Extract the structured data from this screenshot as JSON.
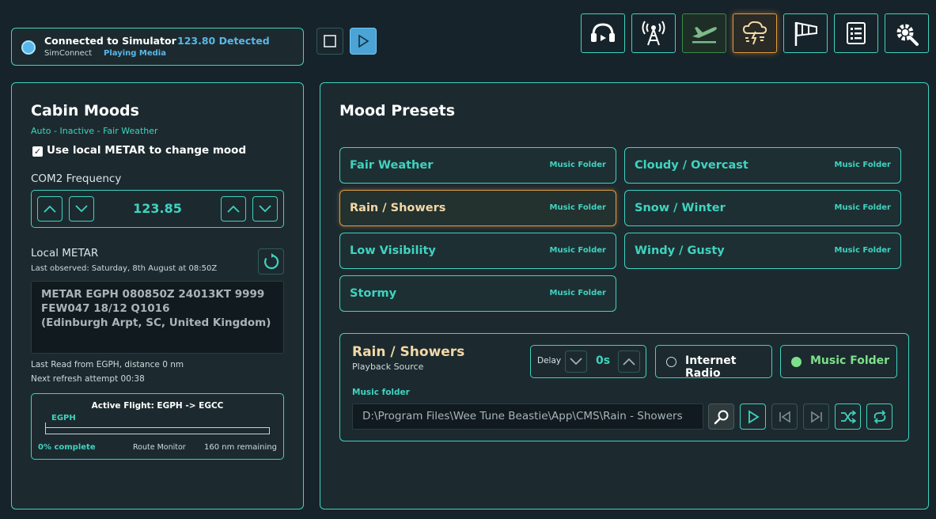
{
  "status": {
    "connection": "Connected to Simulator",
    "detected": "123.80 Detected",
    "source": "SimConnect",
    "media": "Playing Media"
  },
  "top_icons": [
    "headset-icon",
    "radio-tower-icon",
    "takeoff-icon",
    "weather-icon",
    "windsock-icon",
    "checklist-icon",
    "settings-icon"
  ],
  "left": {
    "title": "Cabin Moods",
    "subtitle": "Auto - Inactive - Fair Weather",
    "metar_checkbox_label": "Use local METAR to change mood",
    "com2_label": "COM2 Frequency",
    "com2_value": "123.85",
    "metar_label": "Local METAR",
    "last_observed": "Last observed: Saturday, 8th August at 08:50Z",
    "metar_line1": "METAR EGPH 080850Z 24013KT 9999",
    "metar_line2": "FEW047 18/12 Q1016",
    "metar_line3": "(Edinburgh Arpt, SC, United Kingdom)",
    "last_read": "Last Read from EGPH, distance 0 nm",
    "next_refresh": "Next refresh attempt 00:38",
    "flight": {
      "title": "Active Flight: EGPH -> EGCC",
      "origin": "EGPH",
      "progress_pct": 0,
      "complete": "0% complete",
      "monitor": "Route Monitor",
      "remaining": "160 nm remaining"
    }
  },
  "right": {
    "title": "Mood Presets",
    "presets": [
      {
        "name": "Fair Weather",
        "type": "Music Folder"
      },
      {
        "name": "Cloudy / Overcast",
        "type": "Music Folder"
      },
      {
        "name": "Rain / Showers",
        "type": "Music Folder"
      },
      {
        "name": "Snow / Winter",
        "type": "Music Folder"
      },
      {
        "name": "Low Visibility",
        "type": "Music Folder"
      },
      {
        "name": "Windy / Gusty",
        "type": "Music Folder"
      },
      {
        "name": "Stormy",
        "type": "Music Folder"
      }
    ],
    "source": {
      "title": "Rain / Showers",
      "subtitle": "Playback Source",
      "delay_label": "Delay",
      "delay_value": "0s",
      "option_radio": "Internet Radio",
      "option_folder": "Music Folder",
      "folder_label": "Music folder",
      "folder_path": "D:\\Program Files\\Wee Tune Beastie\\App\\CMS\\Rain - Showers"
    }
  },
  "colors": {
    "accent": "#3fd3c0",
    "selected": "#e59a3d",
    "status_blue": "#58b7e8",
    "folder_active": "#7ee08a"
  }
}
